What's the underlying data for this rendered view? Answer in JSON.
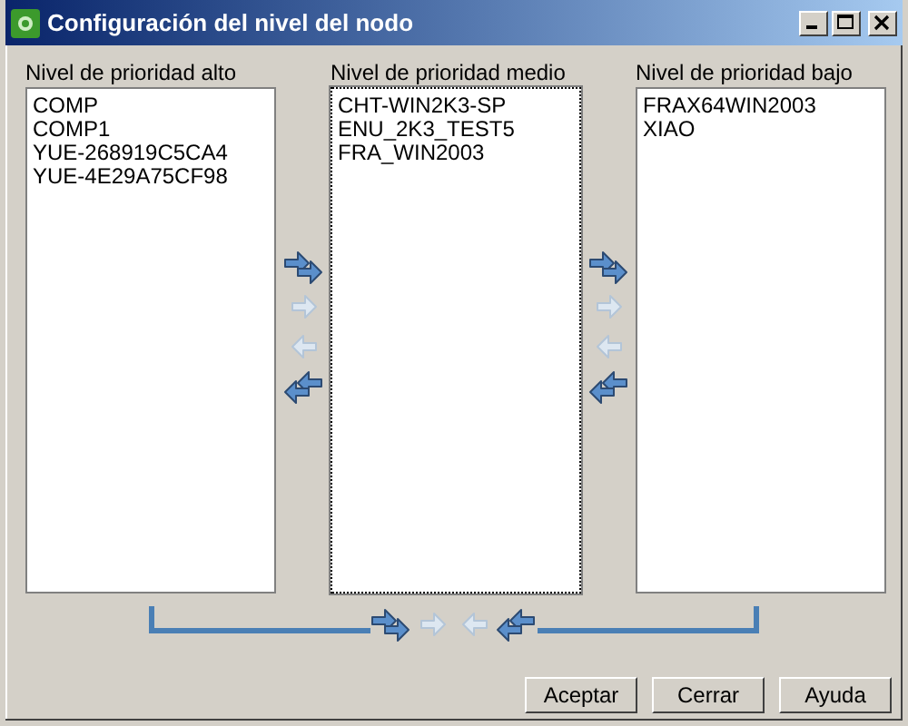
{
  "window": {
    "title": "Configuración del nivel del nodo"
  },
  "lists": [
    {
      "label": "Nivel de prioridad alto",
      "focused": false,
      "items": [
        "COMP",
        "COMP1",
        "YUE-268919C5CA4",
        "YUE-4E29A75CF98"
      ]
    },
    {
      "label": "Nivel de prioridad medio",
      "focused": true,
      "items": [
        "CHT-WIN2K3-SP",
        "ENU_2K3_TEST5",
        "FRA_WIN2003"
      ]
    },
    {
      "label": "Nivel de prioridad bajo",
      "focused": false,
      "items": [
        "FRAX64WIN2003",
        "XIAO"
      ]
    }
  ],
  "transfer_columns": [
    [
      {
        "kind": "double-right",
        "disabled": false
      },
      {
        "kind": "right",
        "disabled": true
      },
      {
        "kind": "left",
        "disabled": true
      },
      {
        "kind": "double-left",
        "disabled": false
      }
    ],
    [
      {
        "kind": "double-right",
        "disabled": false
      },
      {
        "kind": "right",
        "disabled": true
      },
      {
        "kind": "left",
        "disabled": true
      },
      {
        "kind": "double-left",
        "disabled": false
      }
    ]
  ],
  "bottom_transfer": [
    {
      "kind": "double-right",
      "disabled": false
    },
    {
      "kind": "right",
      "disabled": true
    },
    {
      "kind": "left",
      "disabled": true
    },
    {
      "kind": "double-left",
      "disabled": false
    }
  ],
  "buttons": [
    "Aceptar",
    "Cerrar",
    "Ayuda"
  ]
}
